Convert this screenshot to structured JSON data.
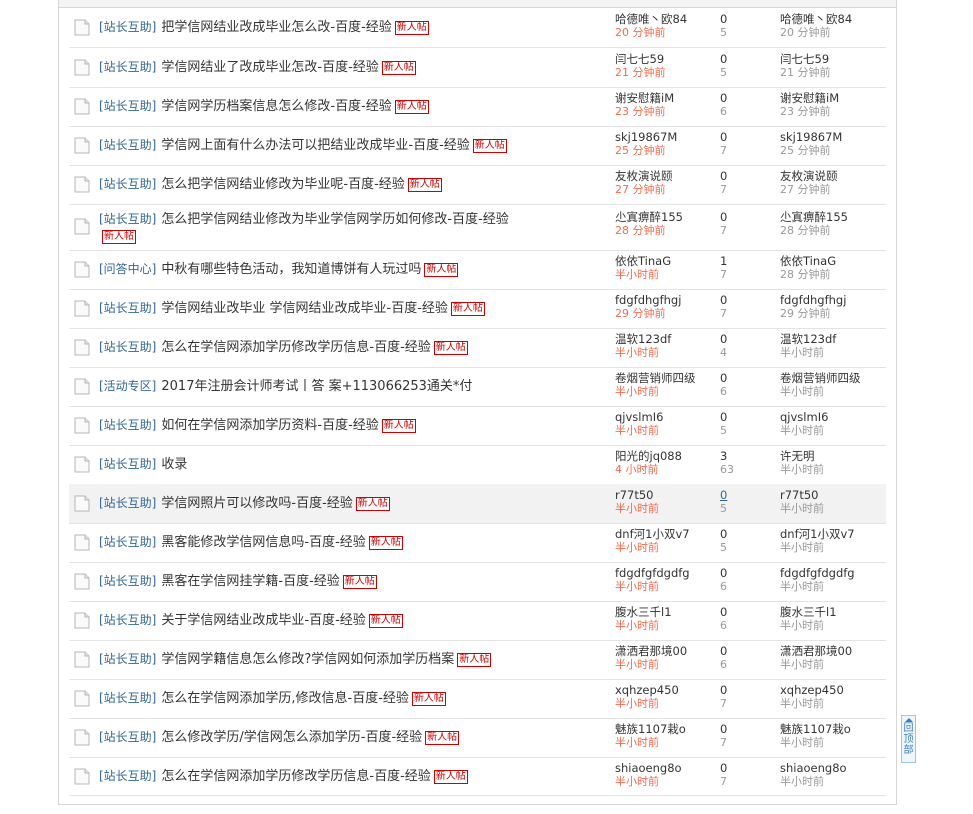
{
  "new_tag": "新人帖",
  "back_to_top": "回顶部",
  "threads": [
    {
      "category": "[站长互助]",
      "title": "把学信网结业改成毕业怎么改-百度-经验",
      "is_new": true,
      "author": "哈德唯丶欧84",
      "post_time": "20 分钟前",
      "replies": "0",
      "views": "5",
      "last_poster": "哈德唯丶欧84",
      "last_time": "20 分钟前"
    },
    {
      "category": "[站长互助]",
      "title": "学信网结业了改成毕业怎改-百度-经验",
      "is_new": true,
      "author": "闫七七59",
      "post_time": "21 分钟前",
      "replies": "0",
      "views": "5",
      "last_poster": "闫七七59",
      "last_time": "21 分钟前"
    },
    {
      "category": "[站长互助]",
      "title": "学信网学历档案信息怎么修改-百度-经验",
      "is_new": true,
      "author": "谢安慰籍iM",
      "post_time": "23 分钟前",
      "replies": "0",
      "views": "6",
      "last_poster": "谢安慰籍iM",
      "last_time": "23 分钟前"
    },
    {
      "category": "[站长互助]",
      "title": "学信网上面有什么办法可以把结业改成毕业-百度-经验",
      "is_new": true,
      "author": "skj19867M",
      "post_time": "25 分钟前",
      "replies": "0",
      "views": "7",
      "last_poster": "skj19867M",
      "last_time": "25 分钟前"
    },
    {
      "category": "[站长互助]",
      "title": "怎么把学信网结业修改为毕业呢-百度-经验",
      "is_new": true,
      "author": "友枚演说颐",
      "post_time": "27 分钟前",
      "replies": "0",
      "views": "7",
      "last_poster": "友枚演说颐",
      "last_time": "27 分钟前"
    },
    {
      "category": "[站长互助]",
      "title": "怎么把学信网结业修改为毕业学信网学历如何修改-百度-经验",
      "is_new": true,
      "author": "尐寘痹醉155",
      "post_time": "28 分钟前",
      "replies": "0",
      "views": "7",
      "last_poster": "尐寘痹醉155",
      "last_time": "28 分钟前"
    },
    {
      "category": "[问答中心]",
      "title": "中秋有哪些特色活动，我知道博饼有人玩过吗",
      "is_new": true,
      "author": "依依TinaG",
      "post_time": "半小时前",
      "replies": "1",
      "views": "7",
      "last_poster": "依依TinaG",
      "last_time": "28 分钟前"
    },
    {
      "category": "[站长互助]",
      "title": "学信网结业改毕业 学信网结业改成毕业-百度-经验",
      "is_new": true,
      "author": "fdgfdhgfhgj",
      "post_time": "29 分钟前",
      "replies": "0",
      "views": "7",
      "last_poster": "fdgfdhgfhgj",
      "last_time": "29 分钟前"
    },
    {
      "category": "[站长互助]",
      "title": "怎么在学信网添加学历修改学历信息-百度-经验",
      "is_new": true,
      "author": "温软123df",
      "post_time": "半小时前",
      "replies": "0",
      "views": "4",
      "last_poster": "温软123df",
      "last_time": "半小时前"
    },
    {
      "category": "[活动专区]",
      "title": "2017年注册会计师考试丨答 案+113066253通关*付",
      "is_new": false,
      "author": "卷烟营销师四级",
      "post_time": "半小时前",
      "replies": "0",
      "views": "6",
      "last_poster": "卷烟营销师四级",
      "last_time": "半小时前"
    },
    {
      "category": "[站长互助]",
      "title": "如何在学信网添加学历资料-百度-经验",
      "is_new": true,
      "author": "qjvslmI6",
      "post_time": "半小时前",
      "replies": "0",
      "views": "5",
      "last_poster": "qjvslmI6",
      "last_time": "半小时前"
    },
    {
      "category": "[站长互助]",
      "title": "收录",
      "is_new": false,
      "author": "阳光的jq088",
      "post_time": "4 小时前",
      "replies": "3",
      "views": "63",
      "last_poster": "许无明",
      "last_time": "半小时前"
    },
    {
      "category": "[站长互助]",
      "title": "学信网照片可以修改吗-百度-经验",
      "is_new": true,
      "author": "r77t50",
      "post_time": "半小时前",
      "replies": "0",
      "views": "5",
      "last_poster": "r77t50",
      "last_time": "半小时前"
    },
    {
      "category": "[站长互助]",
      "title": "黑客能修改学信网信息吗-百度-经验",
      "is_new": true,
      "author": "dnf河1小双v7",
      "post_time": "半小时前",
      "replies": "0",
      "views": "5",
      "last_poster": "dnf河1小双v7",
      "last_time": "半小时前"
    },
    {
      "category": "[站长互助]",
      "title": "黑客在学信网挂学籍-百度-经验",
      "is_new": true,
      "author": "fdgdfgfdgdfg",
      "post_time": "半小时前",
      "replies": "0",
      "views": "6",
      "last_poster": "fdgdfgfdgdfg",
      "last_time": "半小时前"
    },
    {
      "category": "[站长互助]",
      "title": "关于学信网结业改成毕业-百度-经验",
      "is_new": true,
      "author": "腹水三千l1",
      "post_time": "半小时前",
      "replies": "0",
      "views": "6",
      "last_poster": "腹水三千l1",
      "last_time": "半小时前"
    },
    {
      "category": "[站长互助]",
      "title": "学信网学籍信息怎么修改?学信网如何添加学历档案",
      "is_new": true,
      "author": "潇洒君那境00",
      "post_time": "半小时前",
      "replies": "0",
      "views": "6",
      "last_poster": "潇洒君那境00",
      "last_time": "半小时前"
    },
    {
      "category": "[站长互助]",
      "title": "怎么在学信网添加学历,修改信息-百度-经验",
      "is_new": true,
      "author": "xqhzep450",
      "post_time": "半小时前",
      "replies": "0",
      "views": "7",
      "last_poster": "xqhzep450",
      "last_time": "半小时前"
    },
    {
      "category": "[站长互助]",
      "title": "怎么修改学历/学信网怎么添加学历-百度-经验",
      "is_new": true,
      "author": "魅族1107栽o",
      "post_time": "半小时前",
      "replies": "0",
      "views": "7",
      "last_poster": "魅族1107栽o",
      "last_time": "半小时前"
    },
    {
      "category": "[站长互助]",
      "title": "怎么在学信网添加学历修改学历信息-百度-经验",
      "is_new": true,
      "author": "shiaoeng8o",
      "post_time": "半小时前",
      "replies": "0",
      "views": "7",
      "last_poster": "shiaoeng8o",
      "last_time": "半小时前"
    }
  ]
}
